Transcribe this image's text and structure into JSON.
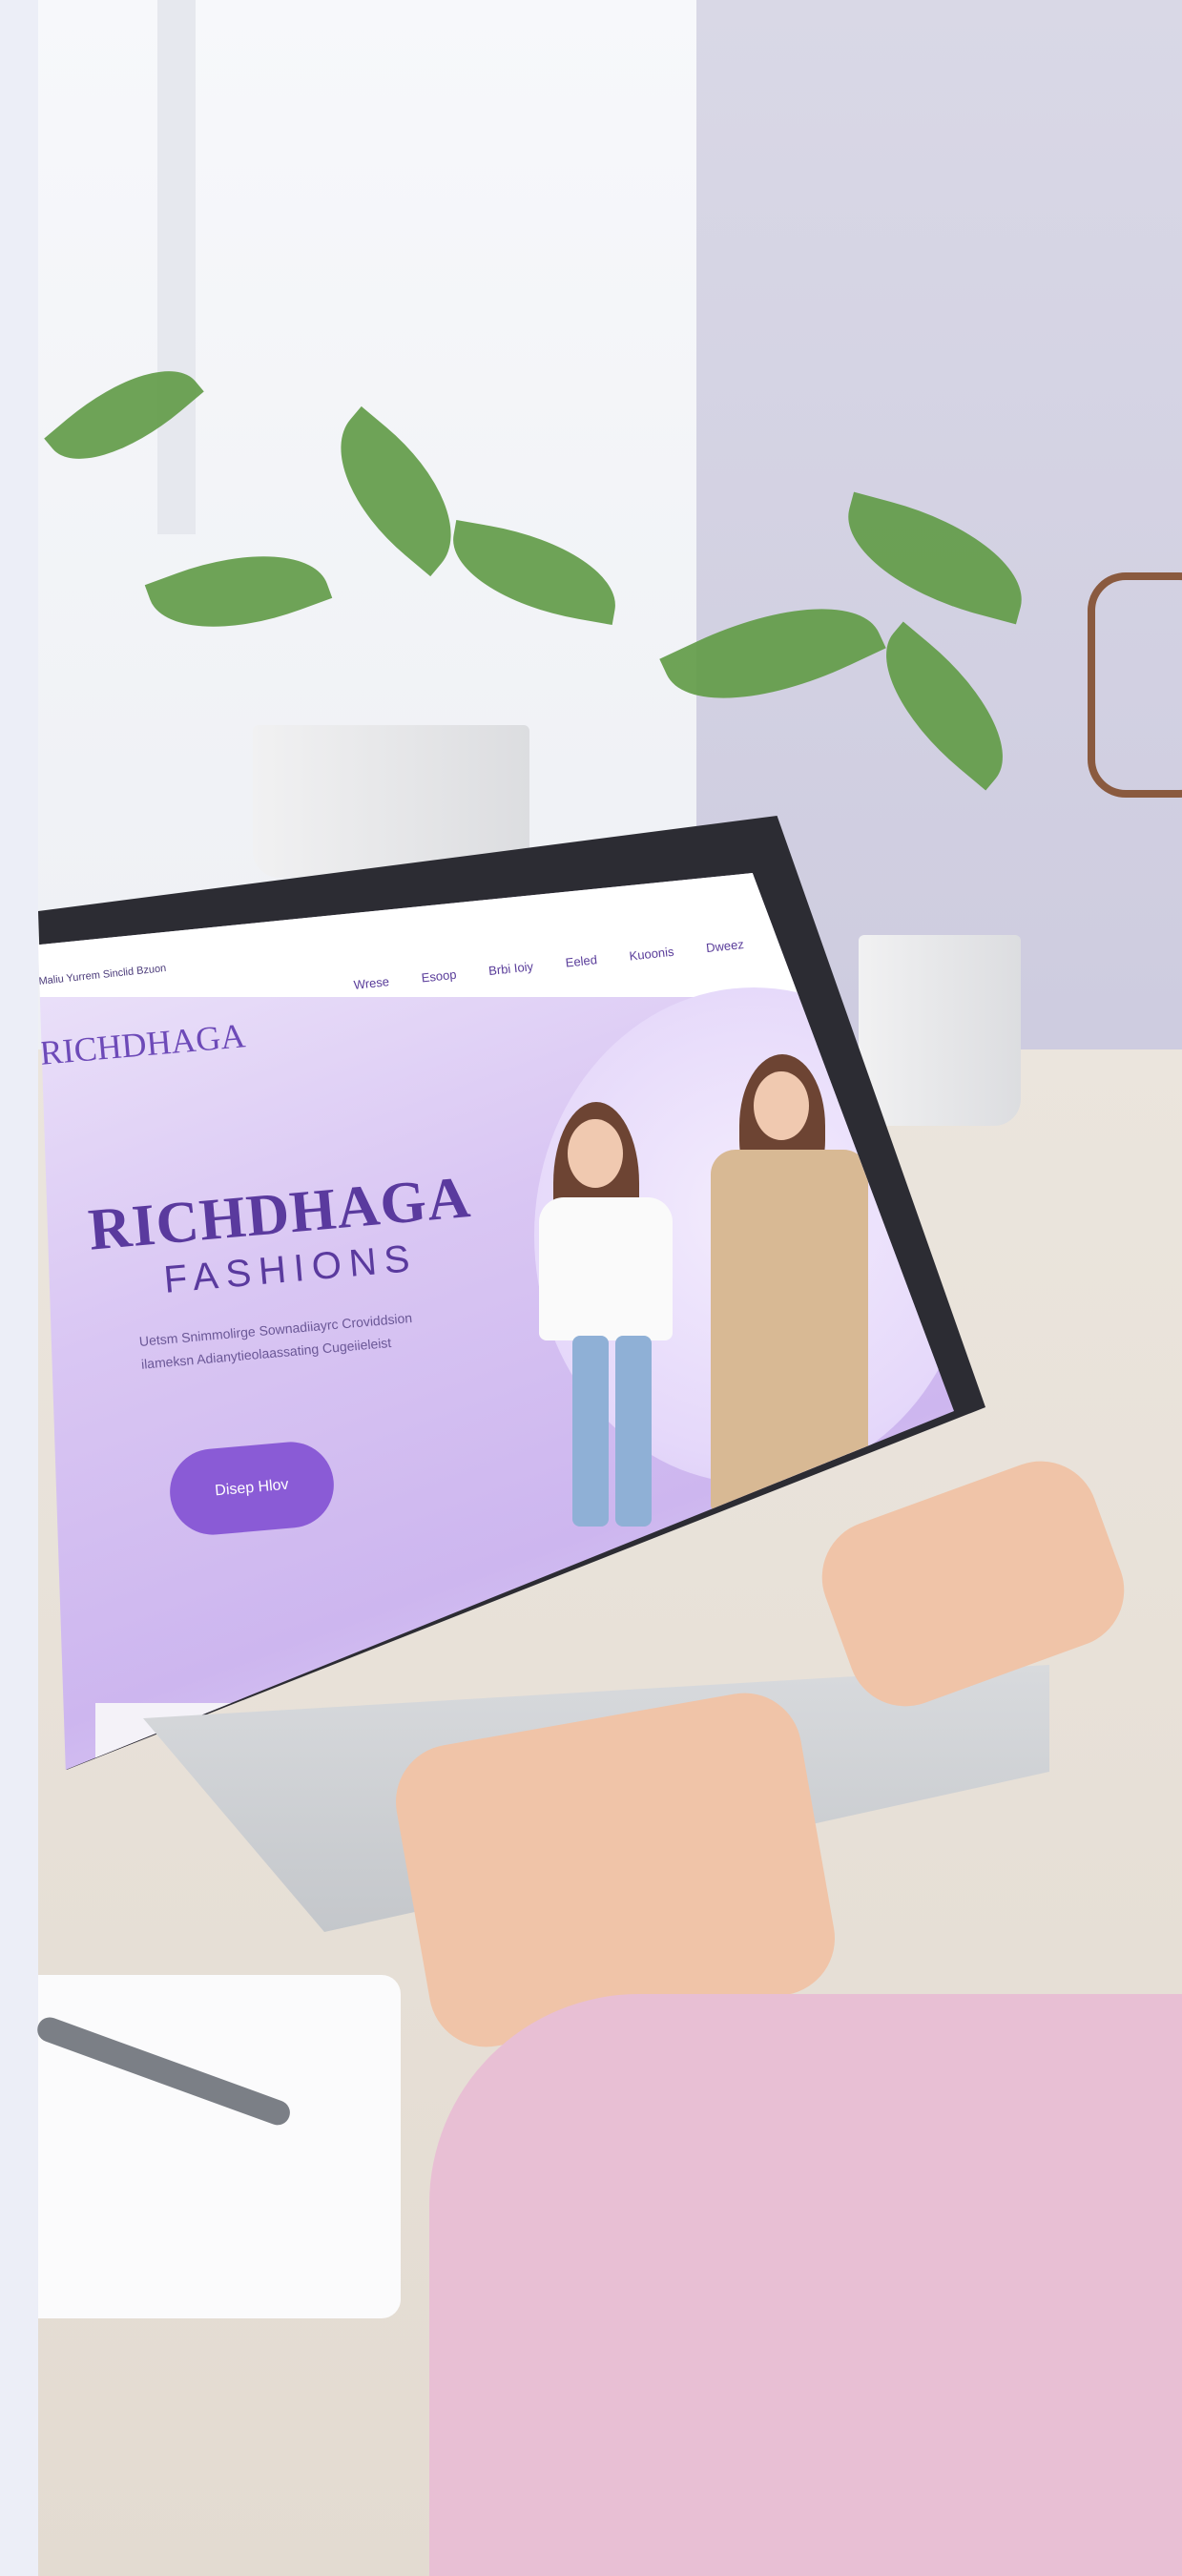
{
  "site": {
    "topbar_text": "Maliu Yurrem Sinclid Bzuon",
    "nav": [
      "Wrese",
      "Esoop",
      "Brbi Ioiy",
      "Eeled",
      "Kuoonis",
      "Dweez"
    ],
    "logo": "RICHDHAGA",
    "hero": {
      "title": "RICHDHAGA",
      "subtitle": "FASHIONS",
      "body_line1": "Uetsm Snimmolirge Sownadiiayrc Croviddsion",
      "body_line2": "ilameksn Adianytieolaassating Cugeiieleist",
      "cta": "Disep Hlov"
    }
  },
  "colors": {
    "brand_purple": "#5a3a9e",
    "cta_purple": "#8a5bd6",
    "hero_lavender": "#d9c6f3"
  }
}
